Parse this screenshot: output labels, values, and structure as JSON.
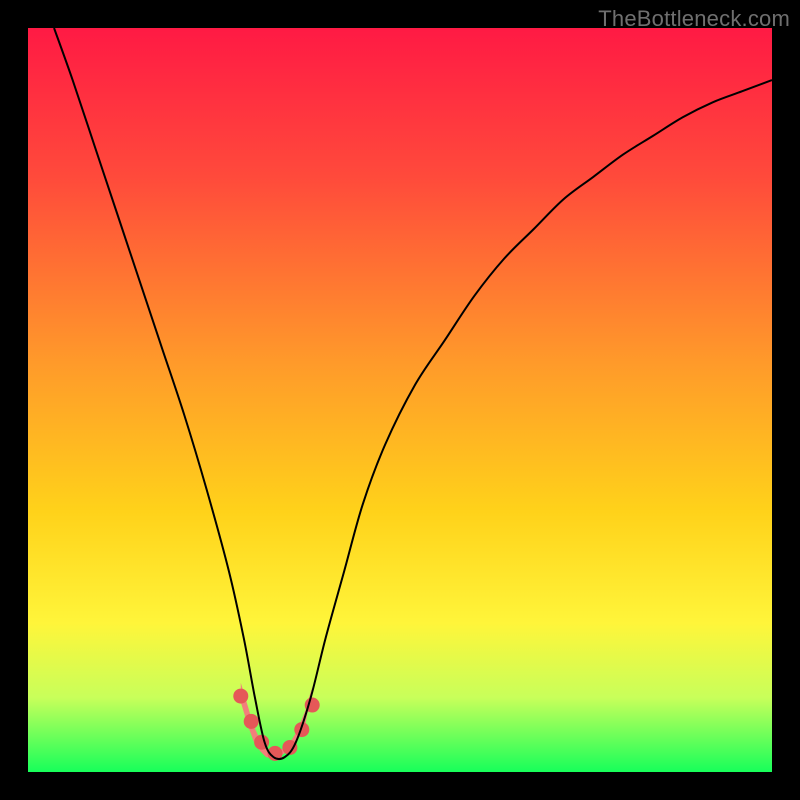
{
  "watermark": "TheBottleneck.com",
  "chart_data": {
    "type": "line",
    "title": "",
    "xlabel": "",
    "ylabel": "",
    "xlim": [
      0,
      1
    ],
    "ylim": [
      0,
      100
    ],
    "gradient_stops": [
      {
        "pct": 0,
        "color": "#ff1a44"
      },
      {
        "pct": 20,
        "color": "#ff4a3b"
      },
      {
        "pct": 45,
        "color": "#ff9a2a"
      },
      {
        "pct": 65,
        "color": "#ffd21a"
      },
      {
        "pct": 80,
        "color": "#fff53a"
      },
      {
        "pct": 90,
        "color": "#c8ff5a"
      },
      {
        "pct": 100,
        "color": "#17ff5a"
      }
    ],
    "series": [
      {
        "name": "curve-v",
        "stroke": "#000000",
        "stroke_width": 2,
        "x": [
          0.035,
          0.06,
          0.09,
          0.12,
          0.15,
          0.18,
          0.21,
          0.24,
          0.27,
          0.29,
          0.305,
          0.318,
          0.33,
          0.345,
          0.36,
          0.38,
          0.4,
          0.425,
          0.45,
          0.48,
          0.52,
          0.56,
          0.6,
          0.64,
          0.68,
          0.72,
          0.76,
          0.8,
          0.84,
          0.88,
          0.92,
          0.96,
          1.0
        ],
        "y": [
          100,
          93,
          84,
          75,
          66,
          57,
          48,
          38,
          27,
          18,
          10,
          4,
          2,
          2,
          4,
          10,
          18,
          27,
          36,
          44,
          52,
          58,
          64,
          69,
          73,
          77,
          80,
          83,
          85.5,
          88,
          90,
          91.5,
          93
        ]
      },
      {
        "name": "macaroni",
        "type": "area",
        "fill": "#f27f7b",
        "x": [
          0.286,
          0.295,
          0.303,
          0.312,
          0.32,
          0.33,
          0.34,
          0.352,
          0.362,
          0.373,
          0.382,
          0.373,
          0.362,
          0.352,
          0.34,
          0.33,
          0.32,
          0.312,
          0.303,
          0.295,
          0.286
        ],
        "y": [
          12.0,
          9.0,
          6.3,
          4.3,
          3.3,
          2.7,
          3.0,
          3.9,
          5.6,
          8.3,
          11.5,
          6.5,
          4.3,
          3.0,
          2.2,
          1.8,
          2.0,
          2.8,
          4.2,
          6.4,
          9.4
        ]
      }
    ],
    "dots": {
      "color": "#e55858",
      "r": 7.5,
      "points": [
        {
          "x": 0.286,
          "y": 10.2
        },
        {
          "x": 0.3,
          "y": 6.8
        },
        {
          "x": 0.314,
          "y": 4.0
        },
        {
          "x": 0.332,
          "y": 2.5
        },
        {
          "x": 0.352,
          "y": 3.3
        },
        {
          "x": 0.368,
          "y": 5.7
        },
        {
          "x": 0.382,
          "y": 9.0
        }
      ]
    }
  }
}
